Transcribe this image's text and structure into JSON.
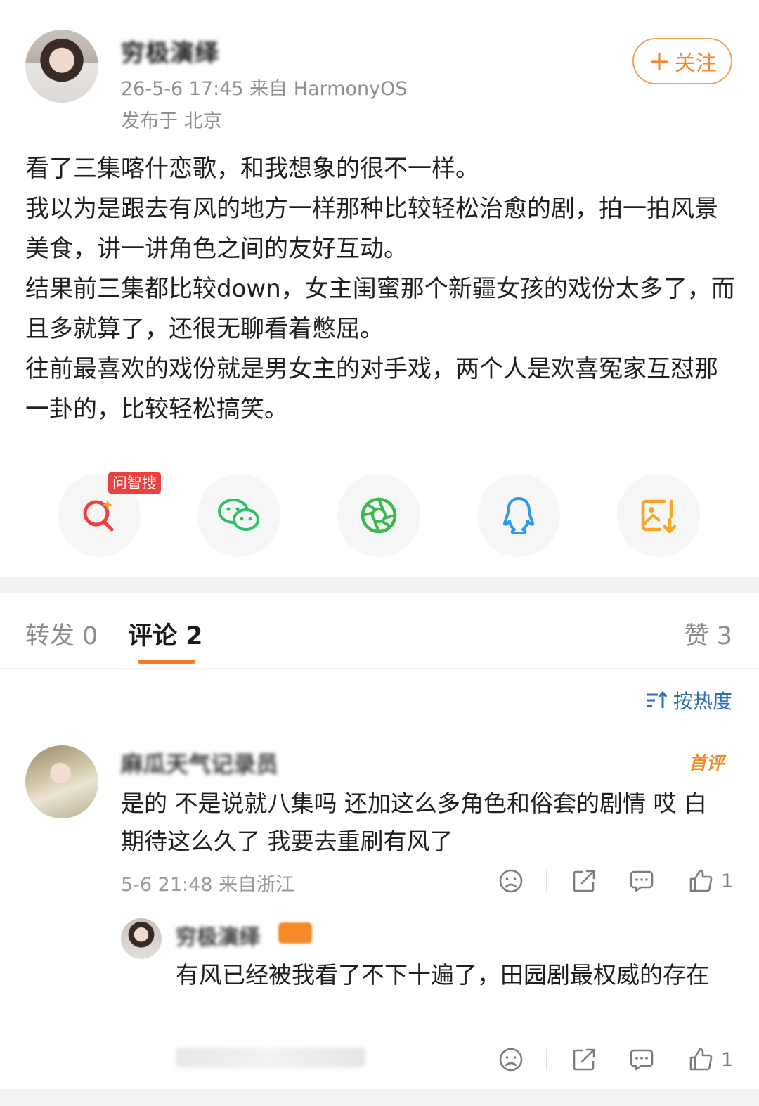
{
  "post": {
    "author_name": "穷极演绎",
    "meta": "26-5-6 17:45  来自 HarmonyOS",
    "location": "发布于 北京",
    "follow_label": "关注",
    "body": [
      "看了三集喀什恋歌，和我想象的很不一样。",
      "我以为是跟去有风的地方一样那种比较轻松治愈的剧，拍一拍风景美食，讲一讲角色之间的友好互动。",
      "结果前三集都比较down，女主闺蜜那个新疆女孩的戏份太多了，而且多就算了，还很无聊看着憋屈。",
      "往前最喜欢的戏份就是男女主的对手戏，两个人是欢喜冤家互怼那一卦的，比较轻松搞笑。"
    ]
  },
  "share": {
    "wenzhi_tag": "问智搜",
    "items": [
      "smart-search",
      "wechat",
      "moments",
      "qq",
      "save-image"
    ]
  },
  "tabs": {
    "repost": "转发 0",
    "comments": "评论 2",
    "likes": "赞 3"
  },
  "sort_label": "按热度",
  "comments": [
    {
      "author": "麻瓜天气记录员",
      "badge": "首评",
      "text": "是的  不是说就八集吗  还加这么多角色和俗套的剧情  哎  白期待这么久了  我要去重刷有风了",
      "meta": "5-6 21:48 来自浙江",
      "like_count": "1"
    }
  ],
  "reply": {
    "author": "穷极演绎",
    "text": "有风已经被我看了不下十遍了，田园剧最权威的存在",
    "like_count": "1"
  },
  "colors": {
    "accent_orange": "#f07d26",
    "link_blue": "#2e6fb0",
    "wechat_green": "#2fbf67",
    "qq_blue": "#2f9ae8",
    "save_orange": "#f5a623",
    "search_red": "#ef4040"
  }
}
